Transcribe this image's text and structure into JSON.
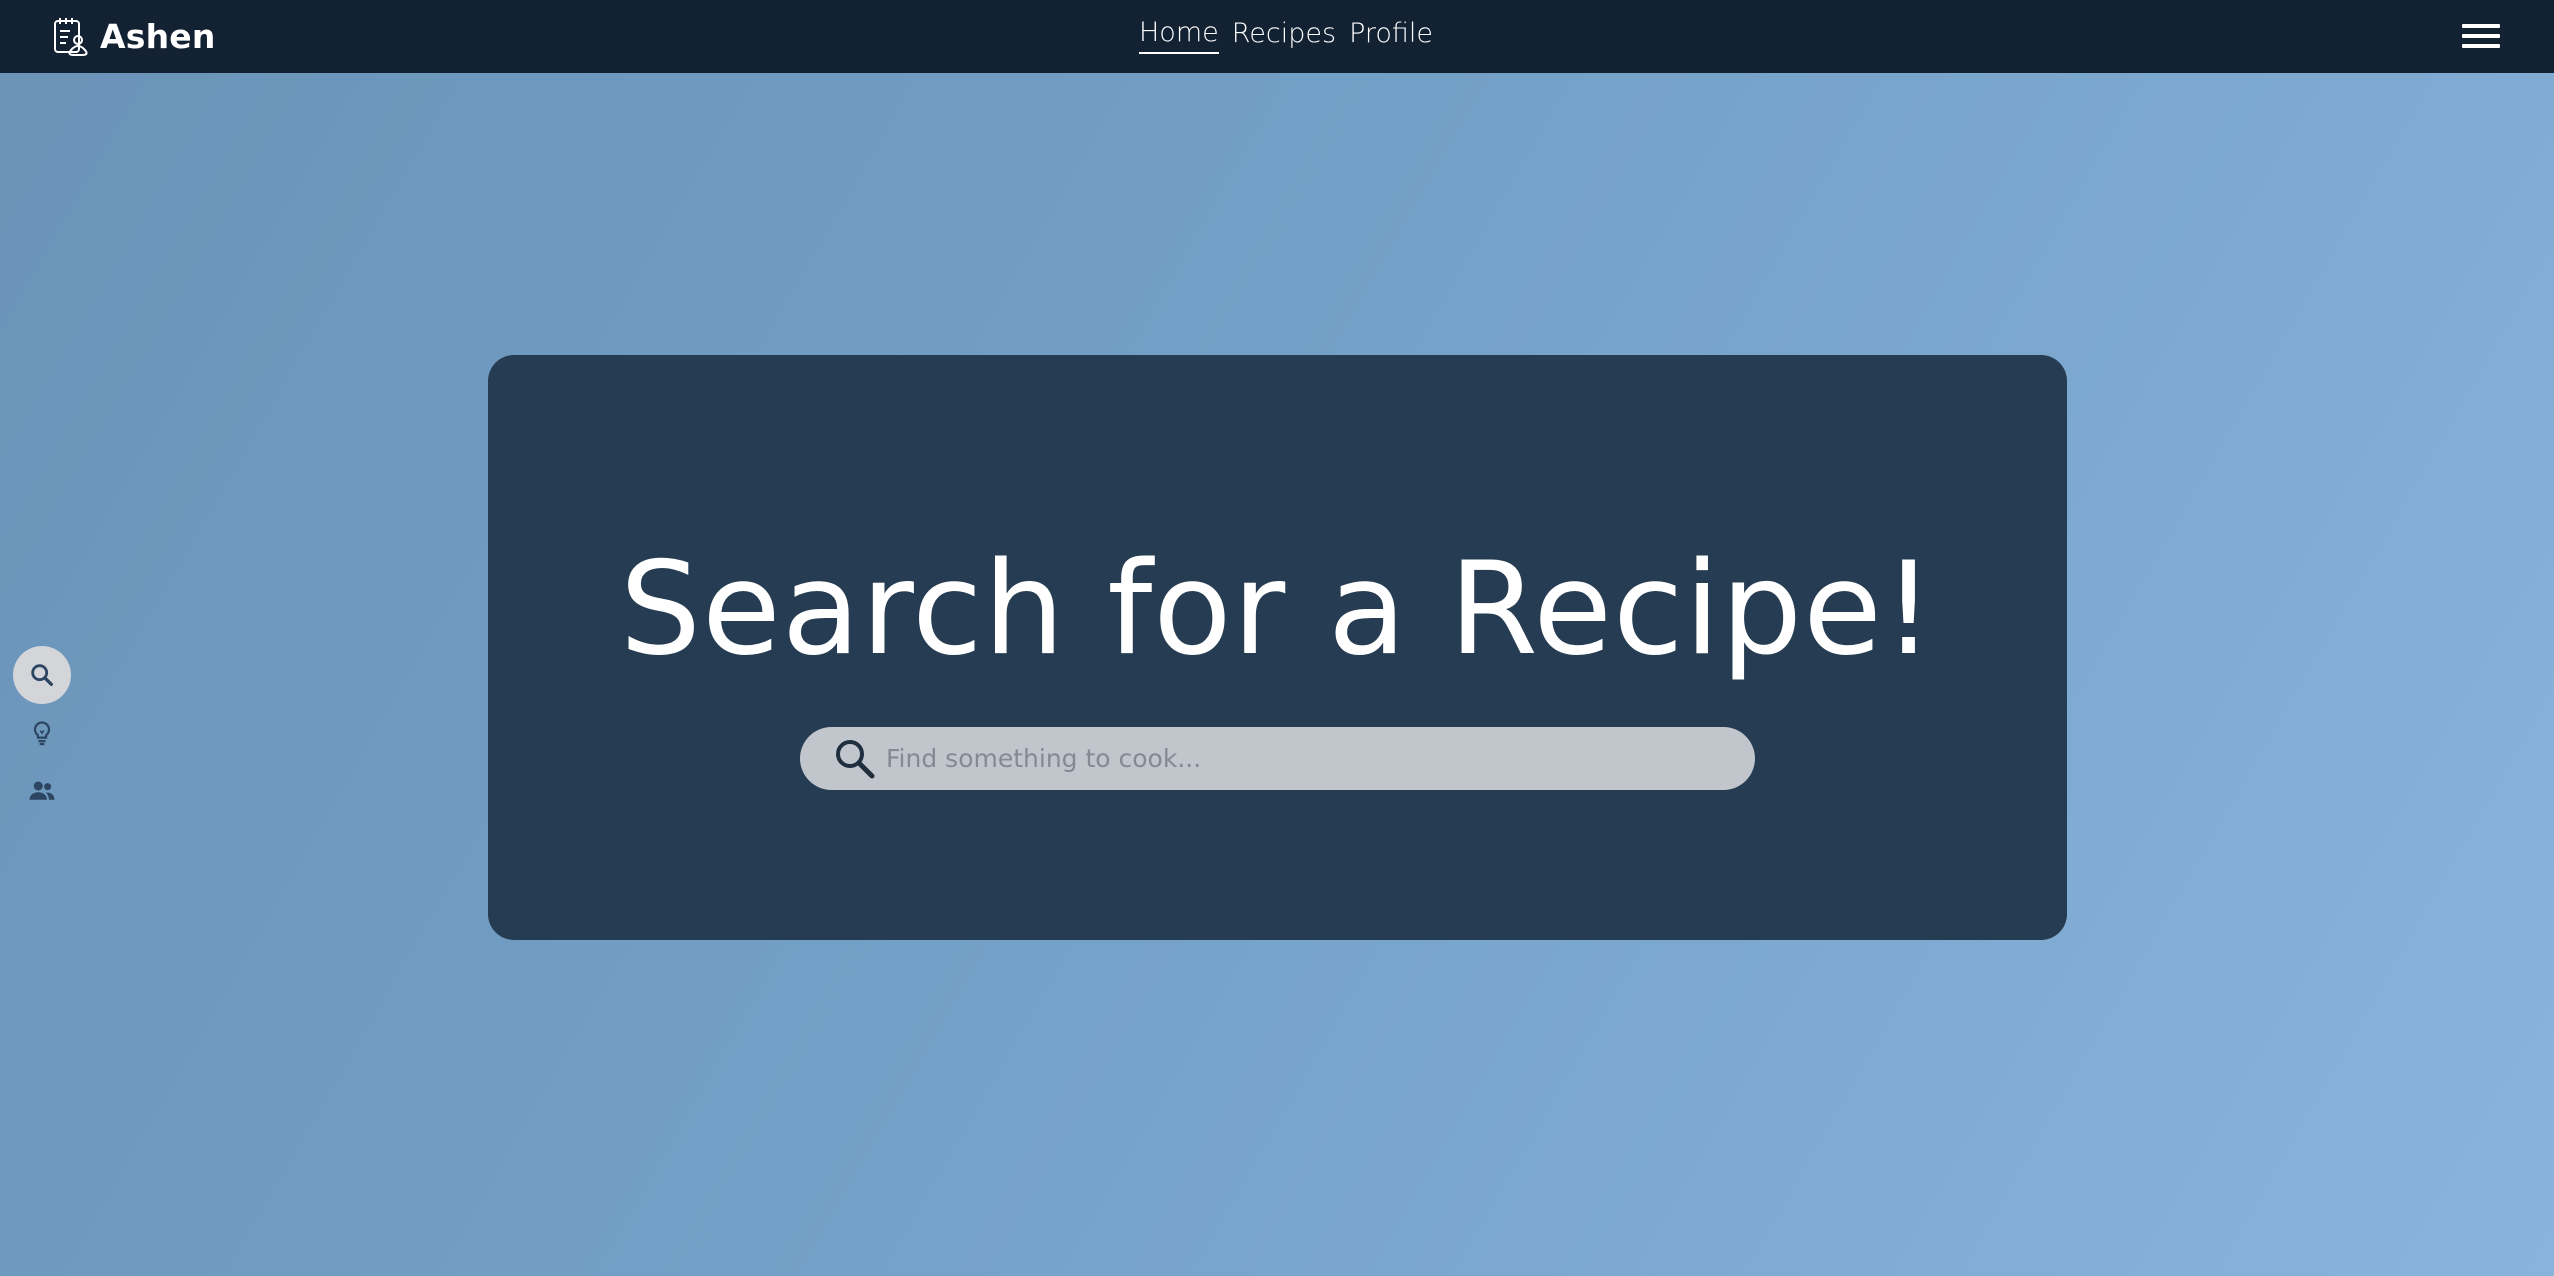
{
  "header": {
    "brand_name": "Ashen",
    "brand_icon": "recipe-notebook-icon",
    "nav": [
      {
        "label": "Home",
        "active": true
      },
      {
        "label": "Recipes",
        "active": false
      },
      {
        "label": "Profile",
        "active": false
      }
    ],
    "menu_icon": "hamburger-menu-icon"
  },
  "sidebar": {
    "items": [
      {
        "icon": "search-icon",
        "active": true
      },
      {
        "icon": "lightbulb-icon",
        "active": false
      },
      {
        "icon": "people-icon",
        "active": false
      }
    ]
  },
  "hero": {
    "title": "Search for a Recipe!",
    "search": {
      "placeholder": "Find something to cook...",
      "value": ""
    }
  },
  "colors": {
    "topbar": "#132233",
    "card": "#263c52",
    "search_bar": "#c1c6cc",
    "background_from": "#6b93b8",
    "background_to": "#88b3dd",
    "rail_icon": "#2c4662"
  }
}
